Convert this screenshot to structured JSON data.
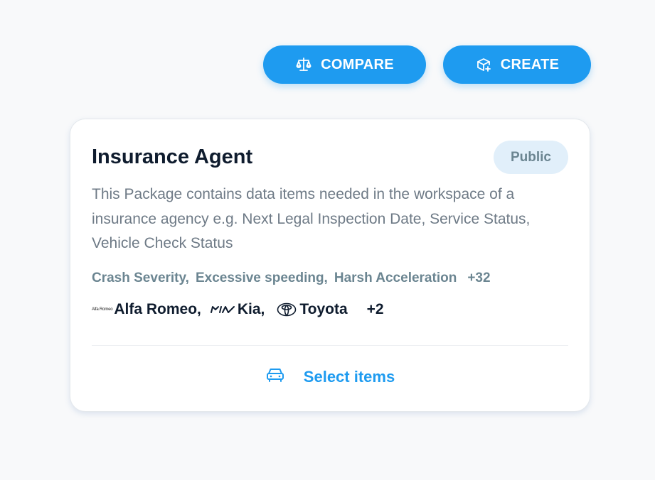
{
  "toolbar": {
    "compare_label": "COMPARE",
    "create_label": "CREATE"
  },
  "card": {
    "title": "Insurance Agent",
    "visibility_badge": "Public",
    "description": "This Package contains data items needed in the workspace of a insurance agency e.g. Next Legal Inspection Date, Service Status, Vehicle Check Status",
    "tags": [
      "Crash Severity,",
      "Excessive speeding,",
      "Harsh Acceleration"
    ],
    "tags_more": "+32",
    "brands": [
      {
        "logo_text": "Alfa Romeo",
        "name": "Alfa Romeo,"
      },
      {
        "logo_text": "",
        "name": "Kia,"
      },
      {
        "logo_text": "",
        "name": "Toyota"
      }
    ],
    "brands_more": "+2",
    "select_label": "Select items"
  },
  "colors": {
    "accent": "#1e9bf0",
    "badge_bg": "#e1effa",
    "badge_text": "#6b8591",
    "title_text": "#0f1c2e",
    "description_text": "#6e7a86"
  },
  "icons": {
    "compare": "scale-icon",
    "create": "cube-plus-icon",
    "select": "car-icon"
  }
}
